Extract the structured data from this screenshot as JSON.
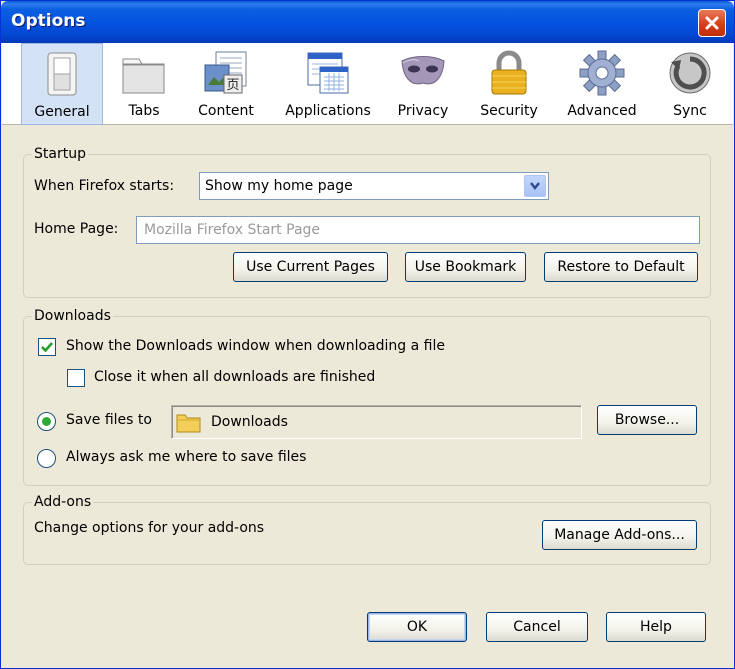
{
  "window": {
    "title": "Options"
  },
  "panes": [
    {
      "label": "General",
      "icon": "switch-icon"
    },
    {
      "label": "Tabs",
      "icon": "tabs-icon"
    },
    {
      "label": "Content",
      "icon": "content-icon"
    },
    {
      "label": "Applications",
      "icon": "applications-icon"
    },
    {
      "label": "Privacy",
      "icon": "mask-icon"
    },
    {
      "label": "Security",
      "icon": "padlock-icon"
    },
    {
      "label": "Advanced",
      "icon": "gear-icon"
    },
    {
      "label": "Sync",
      "icon": "sync-icon"
    }
  ],
  "startup": {
    "title": "Startup",
    "when_label": "When Firefox starts:",
    "when_value": "Show my home page",
    "homepage_label": "Home Page:",
    "homepage_placeholder": "Mozilla Firefox Start Page",
    "use_current": "Use Current Pages",
    "use_bookmark": "Use Bookmark",
    "restore_default": "Restore to Default"
  },
  "downloads": {
    "title": "Downloads",
    "show_window": "Show the Downloads window when downloading a file",
    "show_window_checked": true,
    "close_when_done": "Close it when all downloads are finished",
    "close_when_done_checked": false,
    "save_files_label": "Save files to",
    "save_path": "Downloads",
    "browse": "Browse...",
    "always_ask": "Always ask me where to save files"
  },
  "addons": {
    "title": "Add-ons",
    "desc": "Change options for your add-ons",
    "manage": "Manage Add-ons..."
  },
  "footer": {
    "ok": "OK",
    "cancel": "Cancel",
    "help": "Help"
  },
  "colors": {
    "titlebar": "#0554e1",
    "dialog_bg": "#ece9d8",
    "selected_pane": "#d4e2f6"
  }
}
